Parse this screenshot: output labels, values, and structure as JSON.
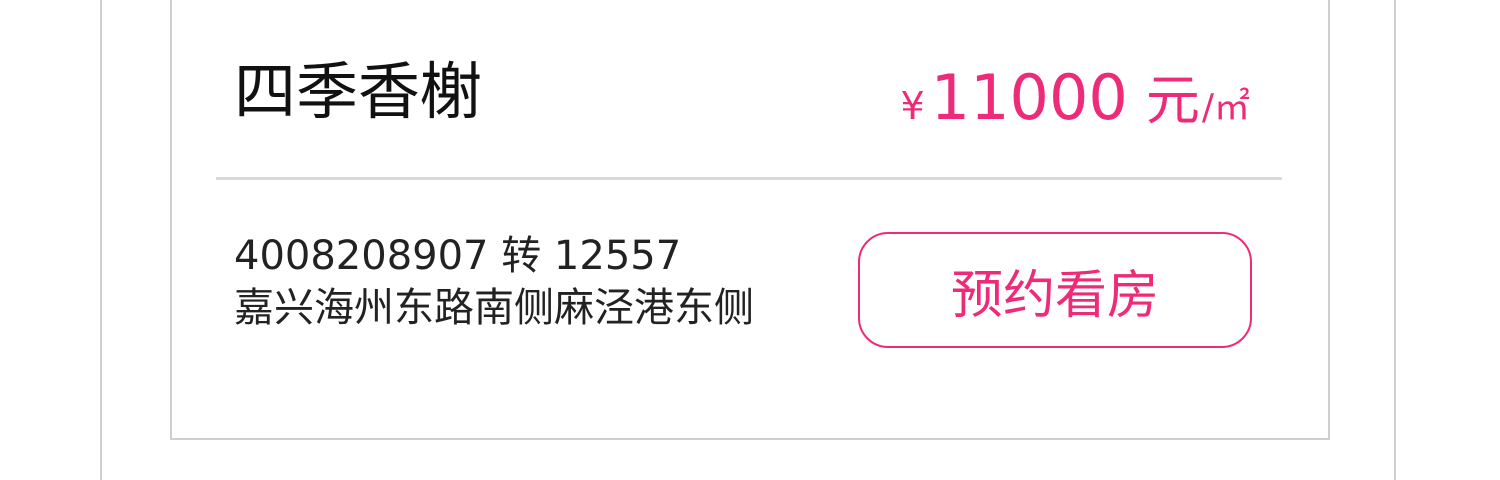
{
  "listing": {
    "name": "四季香榭",
    "price": {
      "currency_symbol": "¥",
      "amount": "11000",
      "unit_main": "元",
      "unit_sub": "/㎡"
    },
    "phone": "4008208907 转 12557",
    "address": "嘉兴海州东路南侧麻泾港东侧",
    "book_button_label": "预约看房"
  },
  "colors": {
    "accent": "#ee2b78",
    "border": "#cfcfcf",
    "divider": "#d9d9d9",
    "text": "#111111"
  }
}
